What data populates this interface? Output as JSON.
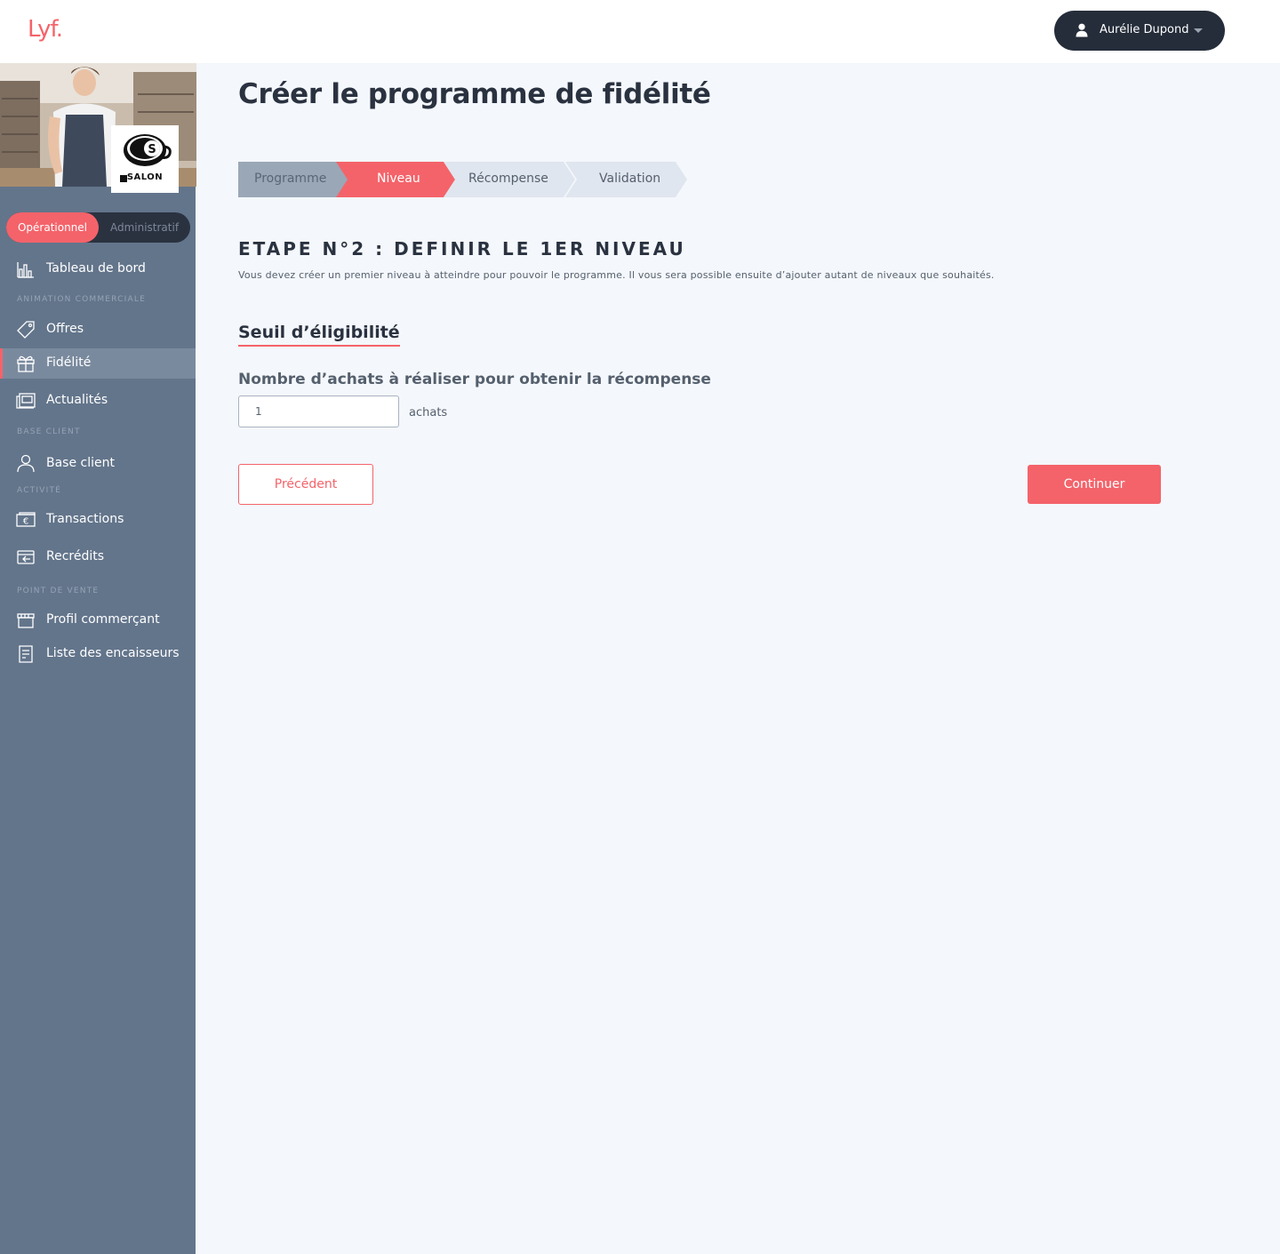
{
  "header": {
    "logo_text": "Lyf.",
    "user_name": "Aurélie Dupond",
    "user_icon": "user-icon",
    "dropdown_icon": "caret-down-icon"
  },
  "sidebar": {
    "store_name": "SALON",
    "mode_toggle": {
      "active": "Opérationnel",
      "inactive": "Administratif"
    },
    "sections": {
      "animation": "ANIMATION COMMERCIALE",
      "base_client": "BASE CLIENT",
      "activite": "ACTIVITÉ",
      "point_de_vente": "POINT DE VENTE"
    },
    "items": [
      {
        "label": "Tableau de bord",
        "icon": "chart-bar-icon"
      },
      {
        "label": "Offres",
        "icon": "tag-icon"
      },
      {
        "label": "Fidélité",
        "icon": "gift-icon",
        "active": true
      },
      {
        "label": "Actualités",
        "icon": "news-icon"
      },
      {
        "label": "Base client",
        "icon": "person-icon"
      },
      {
        "label": "Transactions",
        "icon": "euro-note-icon"
      },
      {
        "label": "Recrédits",
        "icon": "refund-icon"
      },
      {
        "label": "Profil commerçant",
        "icon": "storefront-icon"
      },
      {
        "label": "Liste des encaisseurs",
        "icon": "document-icon"
      }
    ]
  },
  "main": {
    "title": "Créer le programme de fidélité",
    "steps": [
      {
        "label": "Programme",
        "state": "done"
      },
      {
        "label": "Niveau",
        "state": "current"
      },
      {
        "label": "Récompense",
        "state": "upcoming"
      },
      {
        "label": "Validation",
        "state": "upcoming"
      }
    ],
    "step_heading": "ETAPE N°2 : DEFINIR LE 1ER NIVEAU",
    "step_description": "Vous devez créer un premier niveau à atteindre pour pouvoir le programme. Il vous sera possible ensuite d’ajouter autant de niveaux que souhaités.",
    "section_title": "Seuil d’éligibilité",
    "field_label": "Nombre d’achats à réaliser pour obtenir la récompense",
    "field_value": "1",
    "field_unit": "achats",
    "prev_button": "Précédent",
    "next_button": "Continuer"
  },
  "colors": {
    "accent": "#f4636a",
    "sidebar_bg": "#63758b",
    "dark": "#252d3a",
    "page_bg": "#f4f7fb",
    "step_done": "#9aa7b6",
    "step_upcoming": "#e0e6ef"
  }
}
